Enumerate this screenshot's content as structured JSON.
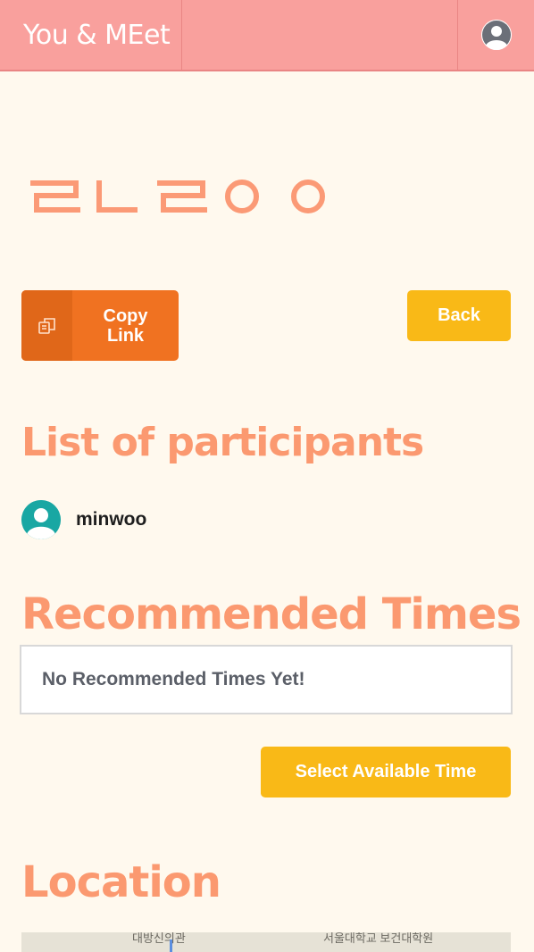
{
  "navbar": {
    "brand": "You & MEet",
    "profile_icon": "user-avatar-icon"
  },
  "room": {
    "title_image": "rlroo"
  },
  "buttons": {
    "copy_link": "Copy\nLink",
    "copy_icon": "copy-icon",
    "back": "Back",
    "select_time": "Select Available Time"
  },
  "participants": {
    "title": "List of participants",
    "items": [
      {
        "name": "minwoo",
        "avatar_color": "#19a7a3"
      }
    ]
  },
  "recommended": {
    "title": "Recommended Times",
    "empty_message": "No Recommended Times Yet!"
  },
  "location": {
    "title": "Location",
    "map_labels": [
      "대방신의관",
      "서울대학교 보건대학원"
    ]
  },
  "colors": {
    "navbar": "#f9a09d",
    "accent_orange": "#f07221",
    "accent_yellow": "#f9b917",
    "title_salmon": "#fb9970",
    "background": "#fff9ee"
  }
}
